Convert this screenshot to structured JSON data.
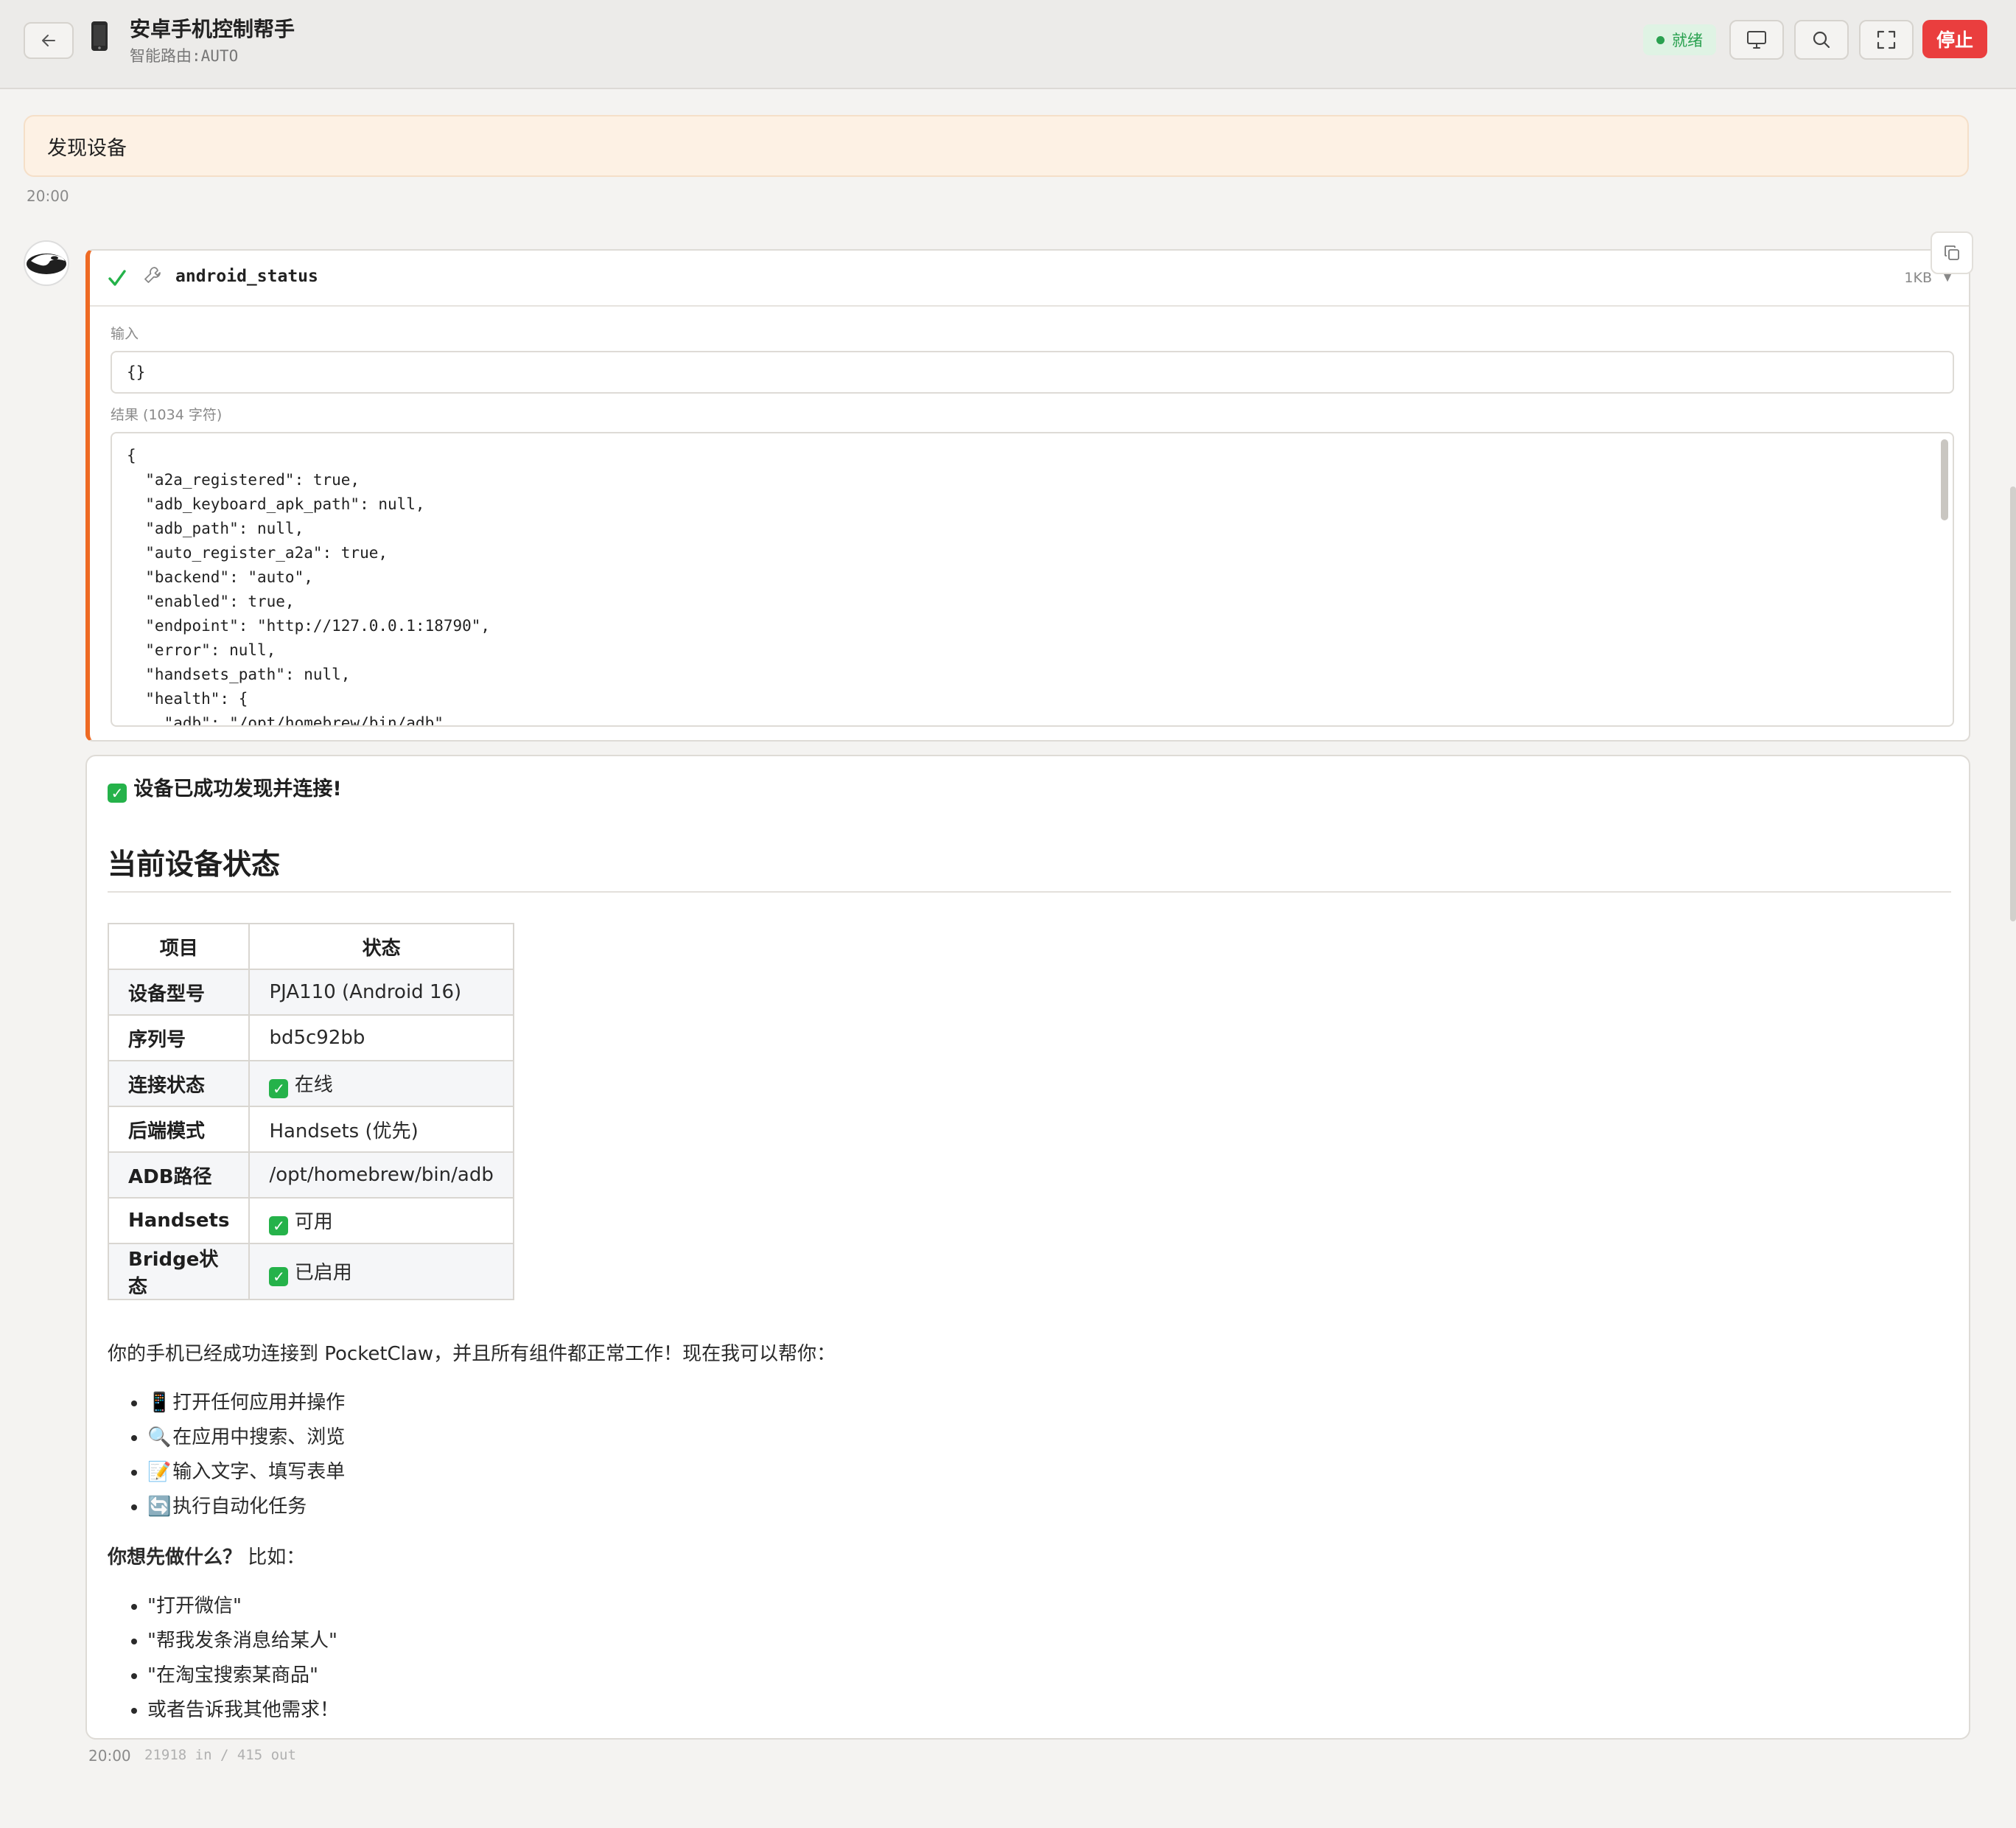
{
  "header": {
    "title": "安卓手机控制帮手",
    "subtitle": "智能路由:AUTO",
    "status": "就绪",
    "stop_label": "停止",
    "icons": [
      "arrow-left-icon",
      "phone-icon",
      "monitor-icon",
      "search-icon",
      "fullscreen-icon"
    ],
    "colors": {
      "status_green": "#2aa150",
      "stop_red": "#ea3e3e",
      "accent_orange": "#ee6a23"
    }
  },
  "user_message": {
    "text": "发现设备",
    "time": "20:00"
  },
  "tool_call": {
    "name": "android_status",
    "size": "1KB",
    "input_label": "输入",
    "input_value": "{}",
    "result_label": "结果 (1034 字符)",
    "result_lines": [
      "{",
      "  \"a2a_registered\": true,",
      "  \"adb_keyboard_apk_path\": null,",
      "  \"adb_path\": null,",
      "  \"auto_register_a2a\": true,",
      "  \"backend\": \"auto\",",
      "  \"enabled\": true,",
      "  \"endpoint\": \"http://127.0.0.1:18790\",",
      "  \"error\": null,",
      "  \"handsets_path\": null,",
      "  \"health\": {",
      "    \"adb\": \"/opt/homebrew/bin/adb\","
    ]
  },
  "assistant": {
    "success_line": "设备已成功发现并连接!",
    "section_title": "当前设备状态",
    "table": {
      "headers": [
        "项目",
        "状态"
      ],
      "rows": [
        {
          "key": "设备型号",
          "value": "PJA110 (Android 16)",
          "check": false
        },
        {
          "key": "序列号",
          "value": "bd5c92bb",
          "check": false
        },
        {
          "key": "连接状态",
          "value": "在线",
          "check": true
        },
        {
          "key": "后端模式",
          "value": "Handsets (优先)",
          "check": false
        },
        {
          "key": "ADB路径",
          "value": "/opt/homebrew/bin/adb",
          "check": false
        },
        {
          "key": "Handsets",
          "value": "可用",
          "check": true
        },
        {
          "key": "Bridge状态",
          "value": "已启用",
          "check": true
        }
      ]
    },
    "paragraph": "你的手机已经成功连接到 PocketClaw，并且所有组件都正常工作！现在我可以帮你：",
    "capabilities": [
      {
        "icon": "📱",
        "text": "打开任何应用并操作"
      },
      {
        "icon": "🔍",
        "text": "在应用中搜索、浏览"
      },
      {
        "icon": "📝",
        "text": "输入文字、填写表单"
      },
      {
        "icon": "🔄",
        "text": "执行自动化任务"
      }
    ],
    "question_bold": "你想先做什么？",
    "question_rest": " 比如：",
    "examples": [
      "\"打开微信\"",
      "\"帮我发条消息给某人\"",
      "\"在淘宝搜索某商品\"",
      "或者告诉我其他需求！"
    ],
    "time": "20:00",
    "tokens": "21918 in / 415 out"
  }
}
